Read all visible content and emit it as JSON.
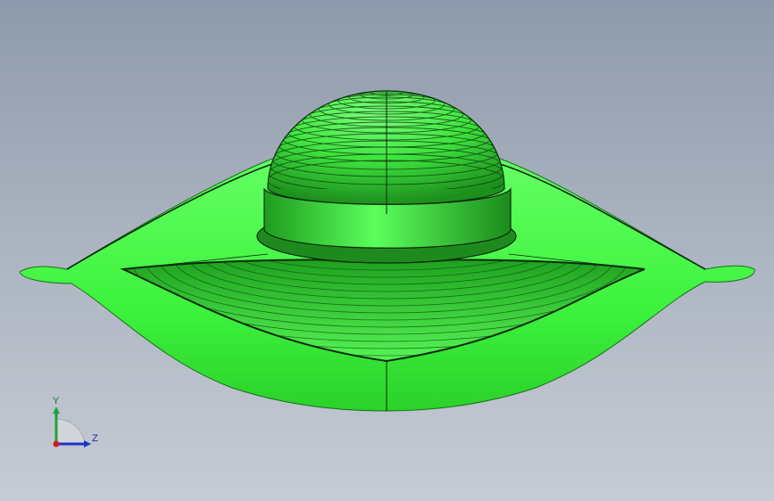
{
  "viewport": {
    "background_top": "#8e9aab",
    "background_bottom": "#c6ccd5",
    "model_color": "#3df23d",
    "model_shade": "#22b322",
    "edge_color": "#0b2a0b"
  },
  "triad": {
    "y_label": "Y",
    "z_label": "Z",
    "y_color": "#1aa53a",
    "z_color": "#1a34c8",
    "x_color": "#d21c1c"
  }
}
